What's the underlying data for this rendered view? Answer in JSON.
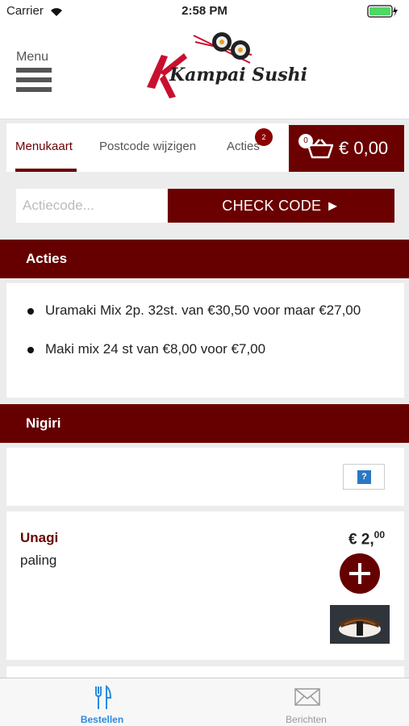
{
  "status_bar": {
    "carrier": "Carrier",
    "time": "2:58 PM"
  },
  "header": {
    "menu_label": "Menu",
    "logo_text": "Kampai Sushi"
  },
  "tabs": [
    {
      "label": "Menukaart",
      "active": true
    },
    {
      "label": "Postcode wijzigen",
      "active": false
    },
    {
      "label": "Acties",
      "active": false,
      "badge": "2"
    }
  ],
  "cart": {
    "count": "0",
    "total": "€ 0,00"
  },
  "promo_code": {
    "placeholder": "Actiecode...",
    "button_label": "CHECK CODE  ►"
  },
  "sections": {
    "acties": {
      "title": "Acties",
      "items": [
        "Uramaki Mix 2p. 32st. van €30,50 voor maar €27,00",
        "Maki mix 24 st van €8,00 voor €7,00"
      ]
    },
    "nigiri": {
      "title": "Nigiri",
      "help_icon_label": "?",
      "products": [
        {
          "name": "Unagi",
          "description": "paling",
          "price_main": "€ 2,",
          "price_cents": "00"
        }
      ]
    }
  },
  "tab_bar": [
    {
      "label": "Bestellen",
      "icon": "fork-knife-icon",
      "active": true
    },
    {
      "label": "Berichten",
      "icon": "envelope-icon",
      "active": false
    }
  ],
  "colors": {
    "accent": "#660000",
    "active_tab_blue": "#2a8be0"
  }
}
